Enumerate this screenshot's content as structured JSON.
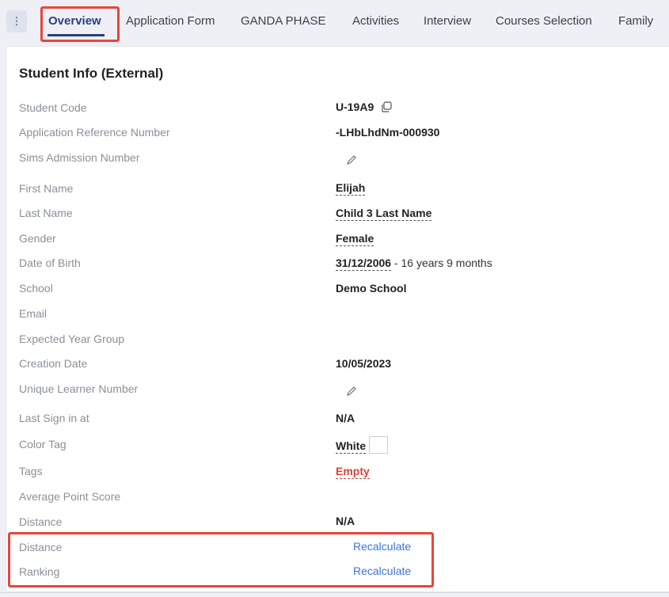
{
  "tabs": [
    {
      "label": "Overview",
      "active": true
    },
    {
      "label": "Application Form"
    },
    {
      "label": "GANDA PHASE"
    },
    {
      "label": "Activities"
    },
    {
      "label": "Interview"
    },
    {
      "label": "Courses Selection"
    },
    {
      "label": "Family"
    }
  ],
  "kebab_glyph": "⋮",
  "section": {
    "title": "Student Info (External)"
  },
  "fields": {
    "student_code": {
      "label": "Student Code",
      "value": "U-19A9"
    },
    "app_ref": {
      "label": "Application Reference Number",
      "value": "-LHbLhdNm-000930"
    },
    "sims": {
      "label": "Sims Admission Number"
    },
    "first_name": {
      "label": "First Name",
      "value": "Elijah"
    },
    "last_name": {
      "label": "Last Name",
      "value": "Child 3 Last Name"
    },
    "gender": {
      "label": "Gender",
      "value": "Female"
    },
    "dob": {
      "label": "Date of Birth",
      "value": "31/12/2006",
      "age": " - 16 years 9 months"
    },
    "school": {
      "label": "School",
      "value": "Demo School"
    },
    "email": {
      "label": "Email"
    },
    "year_group": {
      "label": "Expected Year Group"
    },
    "creation_date": {
      "label": "Creation Date",
      "value": "10/05/2023"
    },
    "uln": {
      "label": "Unique Learner Number"
    },
    "last_sign_in": {
      "label": "Last Sign in at",
      "value": "N/A"
    },
    "color_tag": {
      "label": "Color Tag",
      "value": "White",
      "swatch": "#ffffff"
    },
    "tags": {
      "label": "Tags",
      "value": "Empty"
    },
    "avg_point": {
      "label": "Average Point Score"
    },
    "distance": {
      "label": "Distance",
      "value": "N/A"
    },
    "distance_recalc": {
      "label": "Distance",
      "action": "Recalculate"
    },
    "ranking": {
      "label": "Ranking",
      "action": "Recalculate"
    }
  },
  "icons": {
    "copy": "copy-icon",
    "edit": "pencil-icon",
    "more": "kebab-icon"
  },
  "colors": {
    "highlight": "#e8453c",
    "link": "#3b73d9",
    "active_tab": "#2a3f7a",
    "empty": "#d9413a"
  }
}
